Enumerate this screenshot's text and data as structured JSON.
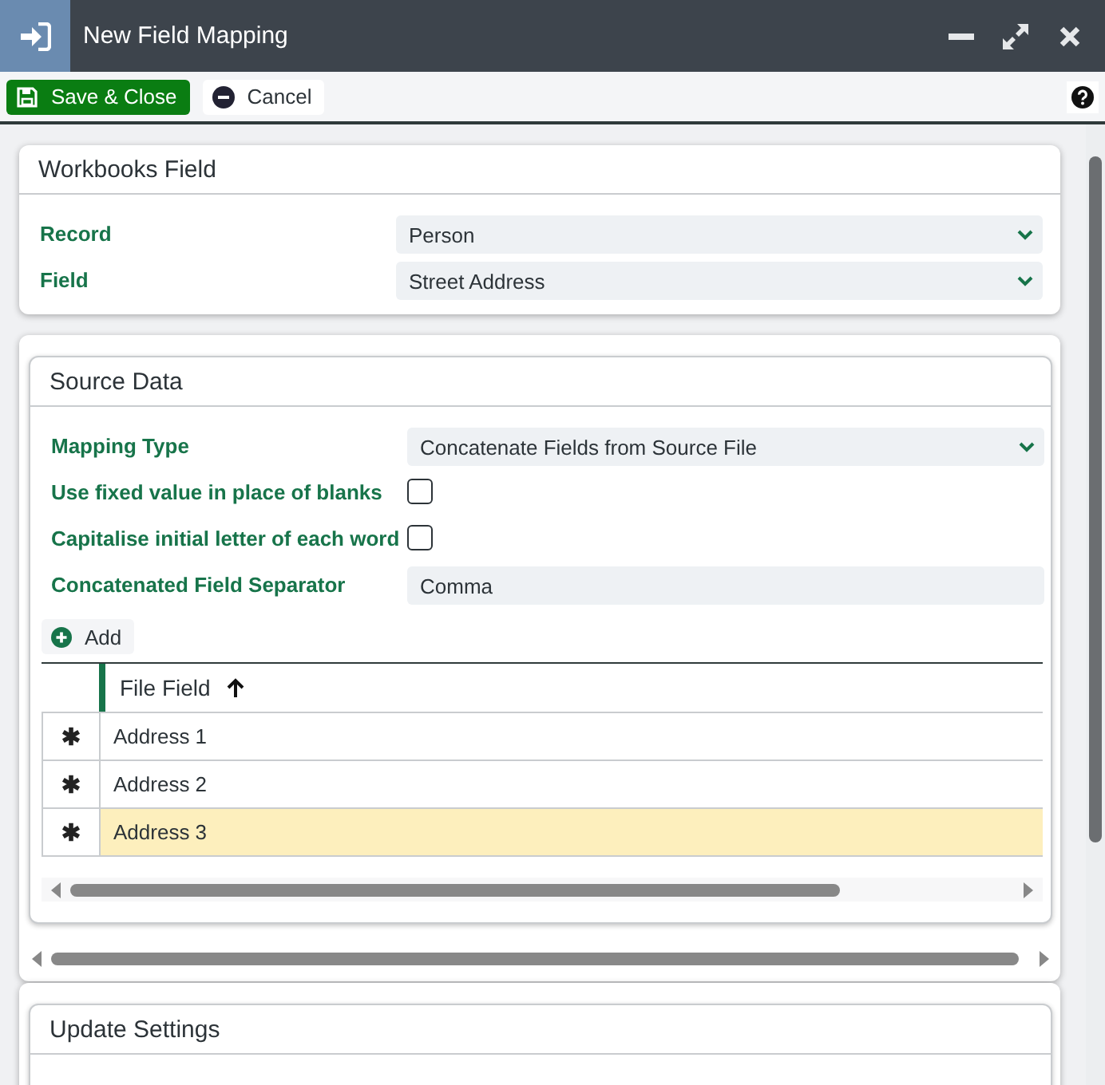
{
  "window": {
    "title": "New Field Mapping"
  },
  "toolbar": {
    "buttons": [
      {
        "label": "Save & Close",
        "kind": "primary"
      },
      {
        "label": "Cancel",
        "kind": "plain"
      }
    ]
  },
  "workbooks_field": {
    "title": "Workbooks Field",
    "fields": [
      {
        "label": "Record",
        "value": "Person",
        "kind": "select"
      },
      {
        "label": "Field",
        "value": "Street Address",
        "kind": "select"
      }
    ]
  },
  "source_data": {
    "title": "Source Data",
    "fields": [
      {
        "label": "Mapping Type",
        "value": "Concatenate Fields from Source File",
        "kind": "select"
      },
      {
        "label": "Use fixed value in place of blanks",
        "checked": false,
        "kind": "checkbox"
      },
      {
        "label": "Capitalise initial letter of each word",
        "checked": false,
        "kind": "checkbox"
      },
      {
        "label": "Concatenated Field Separator",
        "value": "Comma",
        "kind": "text"
      }
    ],
    "add_button": "Add",
    "table": {
      "columns": [
        "File Field"
      ],
      "rows": [
        {
          "file_field": "Address 1",
          "selected": false
        },
        {
          "file_field": "Address 2",
          "selected": false
        },
        {
          "file_field": "Address 3",
          "selected": true
        }
      ]
    }
  },
  "update_settings": {
    "title": "Update Settings"
  }
}
